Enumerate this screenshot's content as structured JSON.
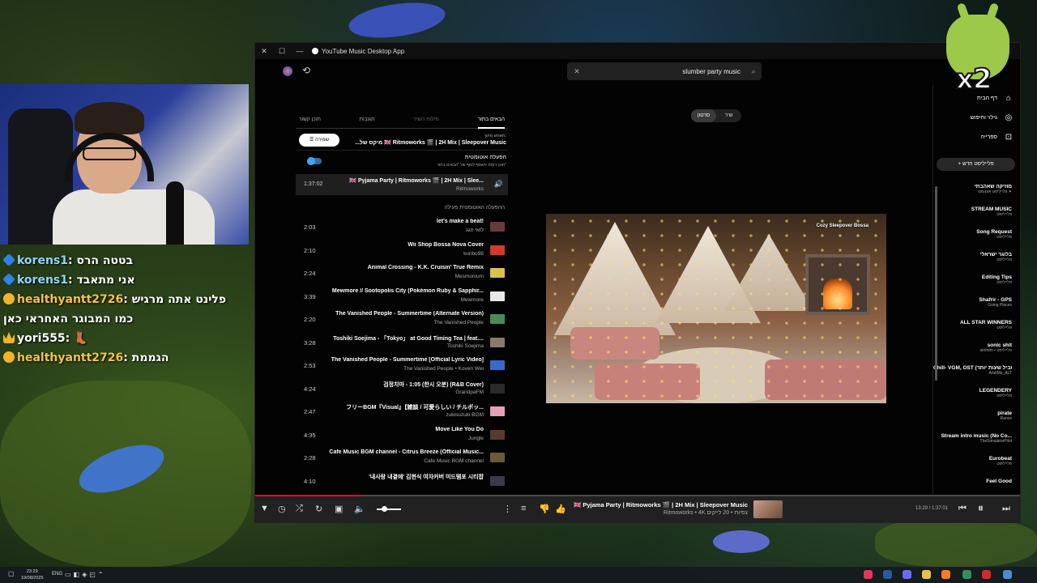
{
  "window": {
    "title": "YouTube Music Desktop App",
    "close": "✕",
    "maximize": "☐",
    "minimize": "—"
  },
  "search": {
    "value": "slumber party music",
    "clear_icon": "clear-icon",
    "search_icon": "search-icon"
  },
  "queue": {
    "tabs": [
      "תוכן קשור",
      "תגובות",
      "מילות השיר",
      "הבאים בתור"
    ],
    "source_label": "משמש מתוך:",
    "source_title": "...מיקס של 🇬🇧 Ritmoworks 🎬 | 2H Mix | Sleepover Music",
    "save_label": "שמירה",
    "autoplay_title": "הפעלה אוטומטית",
    "autoplay_sub": "תוכן דומה יתווסף לסוף של \"הבאים בתור\"",
    "now_playing": {
      "duration": "1:37:02",
      "title": "🇬🇧 Pyjama Party | Ritmoworks 🎬 | 2H Mix | Slee...",
      "artist": "Ritmoworks"
    },
    "section_label": "ההפעלה האוטומטית פעילה",
    "items": [
      {
        "duration": "2:03",
        "title": "let's make a beat!",
        "artist": "לואי זוגג",
        "thumb": "#6a3a3a"
      },
      {
        "duration": "2:10",
        "title": "Wii Shop Bossa Nova Cover",
        "artist": "kuribo98",
        "thumb": "#d23a2a"
      },
      {
        "duration": "2:24",
        "title": "Animal Crossing - K.K. Cruisin' True Remix",
        "artist": "Mesmonium",
        "thumb": "#d9c24a"
      },
      {
        "duration": "3:39",
        "title": "Mewmore // Sootopolis City (Pokémon Ruby & Sapphir...",
        "artist": "Mewmore",
        "thumb": "#e8e8e8"
      },
      {
        "duration": "2:20",
        "title": "The Vanished People - Summertime (Alternate Version)",
        "artist": "The Vanished People",
        "thumb": "#4a8a5a"
      },
      {
        "duration": "3:28",
        "title": "Toshiki Soejima - 「Tokyo」 at Good Timing Tea | feat....",
        "artist": "Toshiki Soejima",
        "thumb": "#8a7a6a"
      },
      {
        "duration": "2:53",
        "title": "The Vanished People - Summertime [Official Lyric Video]",
        "artist": "The Vanished People • Koven Wei",
        "thumb": "#3a6ac8"
      },
      {
        "duration": "4:24",
        "title": "검정치마 - 1:05 (한시 오분) (R&B Cover)",
        "artist": "GrandpaFM",
        "thumb": "#2a2a2a"
      },
      {
        "duration": "2:47",
        "title": "フリーBGM『Visual』【雑談 / 可愛らしい / チルポッ...",
        "artist": "zukisuzuki BGM",
        "thumb": "#e8a0b8"
      },
      {
        "duration": "4:35",
        "title": "Move Like You Do",
        "artist": "Jungle",
        "thumb": "#5a3a2a"
      },
      {
        "duration": "2:28",
        "title": "Cafe Music BGM channel - Citrus Breeze (Official Music...",
        "artist": "Cafe Music BGM channel",
        "thumb": "#6a5a3a"
      },
      {
        "duration": "4:10",
        "title": "'내사랑 내곁에' 김현식 여자커버 미드템포 시티팝",
        "artist": "",
        "thumb": "#3a3a4a"
      }
    ]
  },
  "player": {
    "toggle": [
      "סרטון",
      "שיר"
    ],
    "artwork_label": "Cozy Sleepover Bossa"
  },
  "sidebar": {
    "nav": [
      {
        "label": "דף הבית",
        "icon": "home-icon"
      },
      {
        "label": "גילוי וחיפוש",
        "icon": "explore-icon"
      },
      {
        "label": "ספרייה",
        "icon": "library-icon"
      }
    ],
    "new_playlist": "+ פלייליסט חדש",
    "playlists": [
      {
        "name": "מוזיקה שאהבתי",
        "sub": "פלייליסט אוטומטי ✦"
      },
      {
        "name": "STREAM MUSIC",
        "sub": "פלייליסט"
      },
      {
        "name": "Song Request",
        "sub": "פלייליסט"
      },
      {
        "name": "בלוגר ישראלי",
        "sub": "פלייליסט"
      },
      {
        "name": "Editing Tips",
        "sub": "פלייליסט"
      },
      {
        "name": "Shafrir - GPS",
        "sub": "Going Places"
      },
      {
        "name": "ALL STAR WINNERS",
        "sub": "פלייליסט"
      },
      {
        "name": "sonic shit",
        "sub": "strimim • פלייליסט"
      },
      {
        "name": "Chill- VGM, OST (בשביל שעות יותר)",
        "sub": "ArielMe_ALT"
      },
      {
        "name": "LEGENDERY",
        "sub": "פלייליסט"
      },
      {
        "name": "pirate",
        "sub": "Rance"
      },
      {
        "name": "Stream intro music (No Co...",
        "sub": "TheSimulatorPilot"
      },
      {
        "name": "Eurobeat",
        "sub": "פלייליסט"
      },
      {
        "name": "Feel Good",
        "sub": ""
      }
    ]
  },
  "playerbar": {
    "title": "🇬🇧 Pyjama Party | Ritmoworks 🎬 | 2H Mix | Sleepover Music",
    "meta": "Ritmoworks • 4K צפיות • 20 לייקים",
    "time": "13:29 / 1:37:01",
    "progress": 0.139,
    "volume": 0.3
  },
  "chat": [
    {
      "user": "korens1",
      "message": "בטטה הרס",
      "badge": "blue"
    },
    {
      "user": "korens1",
      "message": "אני מתאבד",
      "badge": "blue"
    },
    {
      "user": "healthyantt2726",
      "message": "פלינט אתה מרגיש",
      "badge": "gold"
    },
    {
      "user": "",
      "message": "כמו המבוגר האחראי כאן",
      "badge": ""
    },
    {
      "user": "yori555",
      "message": "👢",
      "badge": "crown"
    },
    {
      "user": "healthyantt2726",
      "message": "הגממת",
      "badge": "gold"
    }
  ],
  "overlay": {
    "badge": "x2"
  },
  "taskbar": {
    "time": "23:29",
    "date": "19/08/2025",
    "lang": "ENG"
  },
  "colors": {
    "accent": "#ff0033",
    "toggle": "#3ea6ff",
    "app_bg": "#030303"
  }
}
